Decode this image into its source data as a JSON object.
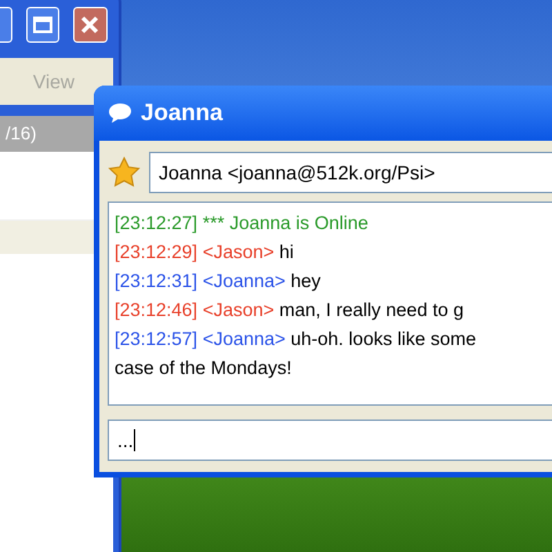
{
  "roster_window": {
    "menu": [
      "View"
    ],
    "list_header": "/16)"
  },
  "chat_window": {
    "title": "Joanna",
    "contact": "Joanna <joanna@512k.org/Psi>",
    "log": [
      {
        "kind": "system",
        "time": "[23:12:27]",
        "text": "*** Joanna is Online"
      },
      {
        "kind": "outgoing",
        "time": "[23:12:29]",
        "nick": "<Jason>",
        "text": "hi"
      },
      {
        "kind": "incoming",
        "time": "[23:12:31]",
        "nick": "<Joanna>",
        "text": "hey"
      },
      {
        "kind": "outgoing",
        "time": "[23:12:46]",
        "nick": "<Jason>",
        "text": "man, I really need to g"
      },
      {
        "kind": "incoming",
        "time": "[23:12:57]",
        "nick": "<Joanna>",
        "text": "uh-oh. looks like some"
      },
      {
        "kind": "continuation",
        "text": "case of the Mondays!"
      }
    ],
    "input": "..."
  }
}
